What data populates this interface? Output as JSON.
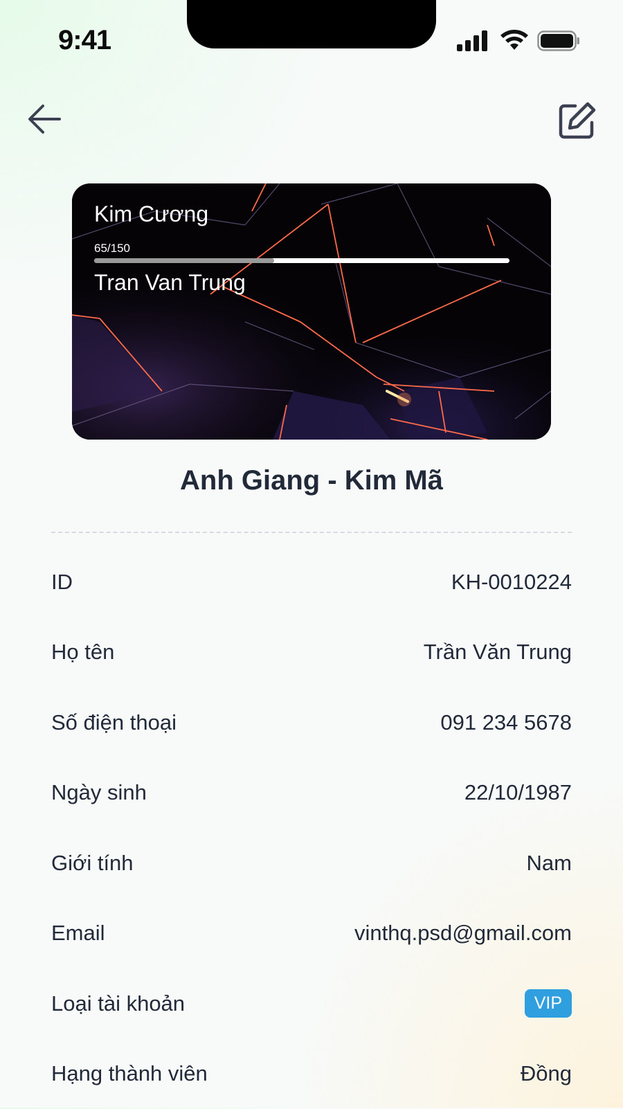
{
  "status_bar": {
    "time": "9:41"
  },
  "card": {
    "tier": "Kim Cương",
    "points": "65/150",
    "progress": 0.433,
    "holder": "Tran Van Trung"
  },
  "store_name": "Anh Giang - Kim Mã",
  "info": {
    "rows": [
      {
        "label": "ID",
        "value": "KH-0010224"
      },
      {
        "label": "Họ tên",
        "value": "Trần Văn Trung"
      },
      {
        "label": "Số điện thoại",
        "value": "091 234 5678"
      },
      {
        "label": "Ngày sinh",
        "value": "22/10/1987"
      },
      {
        "label": "Giới tính",
        "value": "Nam"
      },
      {
        "label": "Email",
        "value": "vinthq.psd@gmail.com"
      },
      {
        "label": "Loại tài khoản",
        "value": "VIP"
      },
      {
        "label": "Hạng thành viên",
        "value": "Đồng"
      }
    ]
  },
  "icons": {
    "back": "arrow-left-icon",
    "edit": "edit-icon",
    "signal": "cellular-signal-icon",
    "wifi": "wifi-icon",
    "battery": "battery-icon"
  },
  "colors": {
    "vip_badge": "#2f9fe0",
    "text": "#222a3a"
  }
}
